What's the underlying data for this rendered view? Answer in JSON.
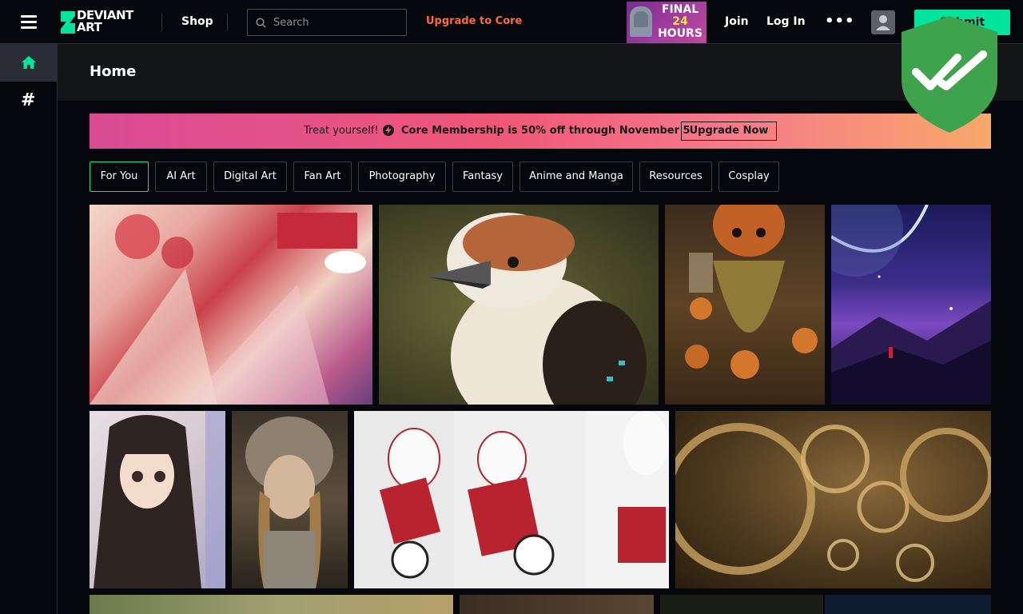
{
  "topbar": {
    "logo_text_line1": "DEVIANT",
    "logo_text_line2": "ART",
    "shop": "Shop",
    "search_placeholder": "Search",
    "upgrade": "Upgrade to Core",
    "promo": {
      "line1": "FINAL",
      "line2": "24",
      "line3": "HOURS"
    },
    "join": "Join",
    "login": "Log In",
    "more": "•••",
    "submit": "Submit"
  },
  "page": {
    "title": "Home"
  },
  "banner": {
    "treat": "Treat yourself!",
    "offer": "Core Membership is 50% off through November 5",
    "cta": "Upgrade Now"
  },
  "chips": [
    "For You",
    "AI Art",
    "Digital Art",
    "Fan Art",
    "Photography",
    "Fantasy",
    "Anime and Manga",
    "Resources",
    "Cosplay"
  ],
  "colors": {
    "accent": "#00e59b",
    "upgrade": "#ff6b35",
    "background": "#06070d"
  }
}
